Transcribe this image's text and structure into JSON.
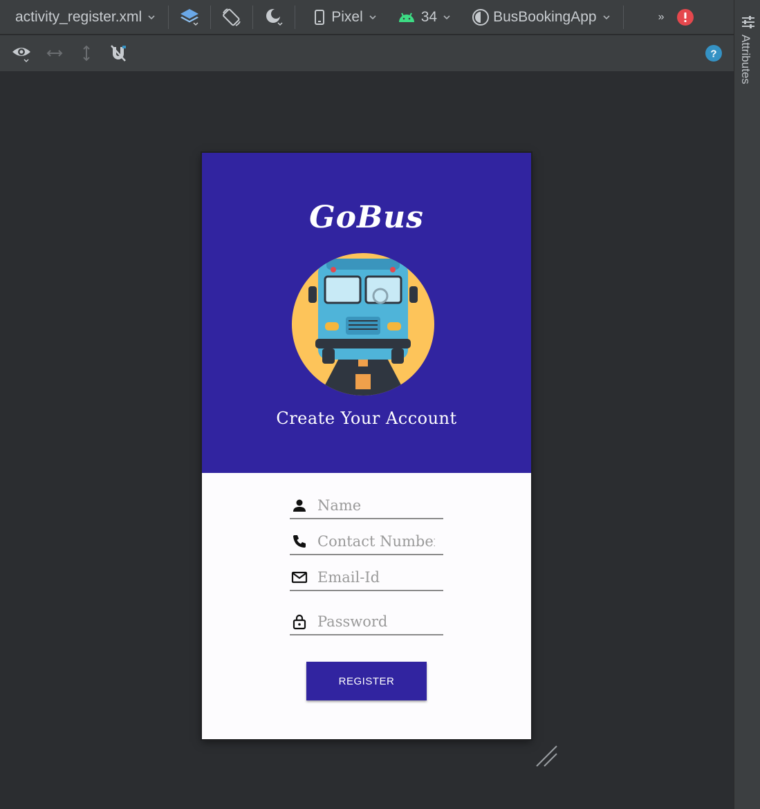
{
  "toolbar": {
    "file_name": "activity_register.xml",
    "device": "Pixel",
    "api_level": "34",
    "app_module": "BusBookingApp",
    "overflow": "»"
  },
  "side_panel": {
    "label": "Attributes"
  },
  "app": {
    "title": "GoBus",
    "subtitle": "Create Your Account",
    "fields": {
      "name_placeholder": "Name",
      "contact_placeholder": "Contact Number",
      "email_placeholder": "Email-Id",
      "password_placeholder": "Password"
    },
    "register_label": "REGISTER"
  },
  "colors": {
    "primary": "#3124a0",
    "ide_bg": "#2b2d30",
    "toolbar_bg": "#3c3f41",
    "error": "#e5484d",
    "help": "#3592c4",
    "android_green": "#3ddc84"
  },
  "icons": [
    "chevron-down-icon",
    "layers-icon",
    "rotate-icon",
    "night-mode-icon",
    "phone-icon",
    "android-icon",
    "theme-icon",
    "error-icon",
    "eye-icon",
    "horizontal-resize-icon",
    "vertical-resize-icon",
    "magnet-off-icon",
    "help-icon",
    "person-icon",
    "call-icon",
    "mail-icon",
    "lock-icon",
    "bus-icon",
    "resize-grip-icon",
    "settings-sliders-icon"
  ]
}
